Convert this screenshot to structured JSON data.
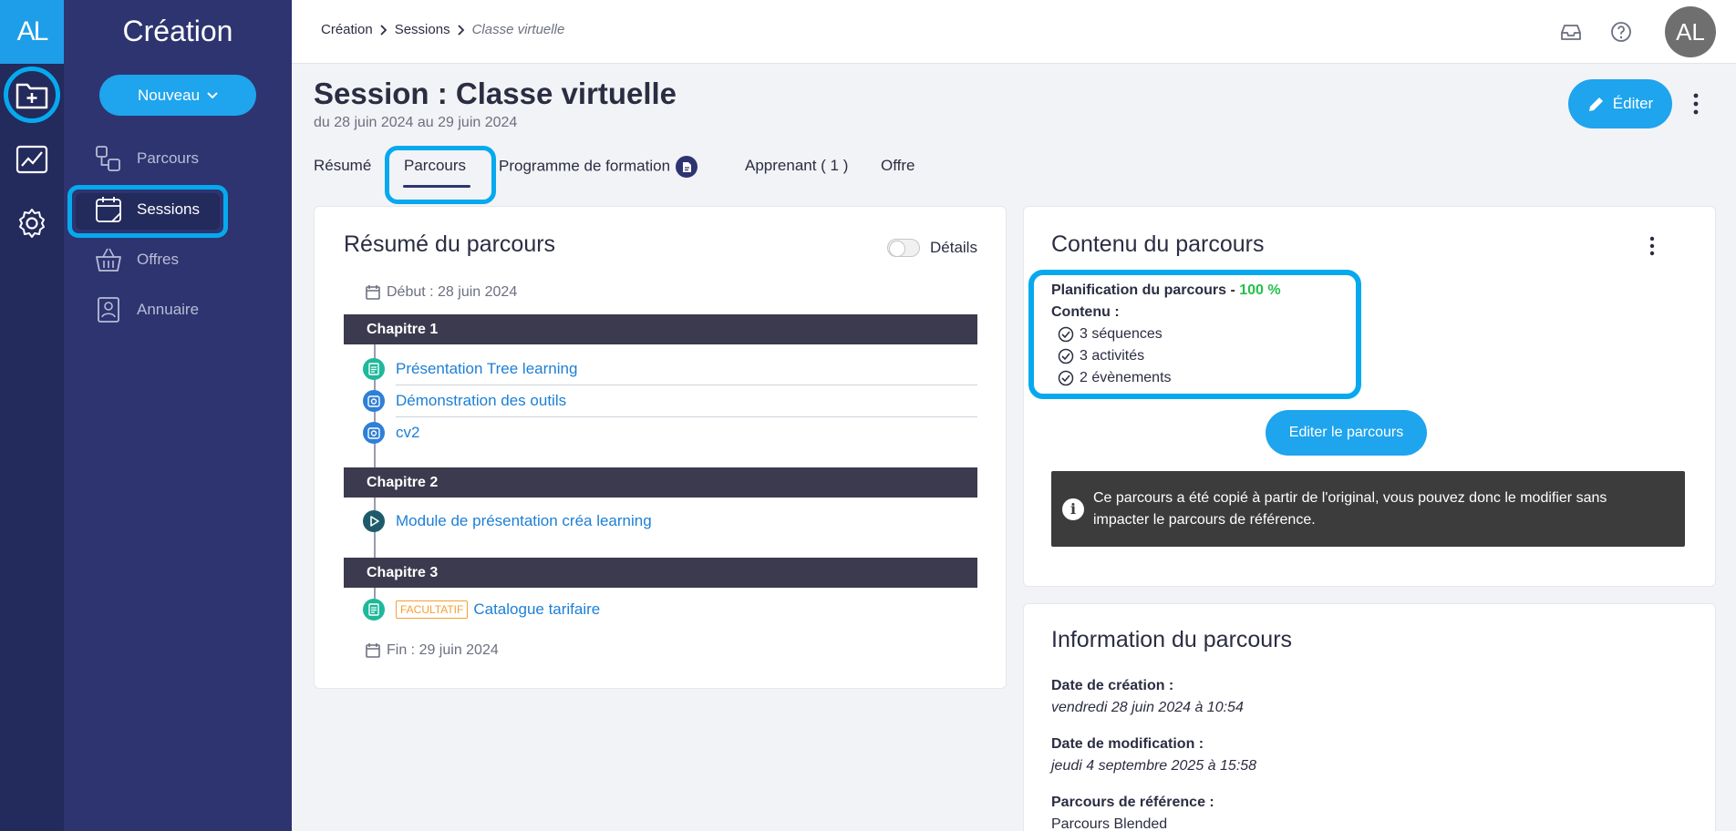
{
  "app": {
    "logo": "AL",
    "module_title": "Création"
  },
  "rail": {
    "icons": [
      "folder-plus-icon",
      "chart-icon",
      "gear-icon"
    ]
  },
  "sidebar": {
    "new_button": "Nouveau",
    "items": [
      {
        "label": "Parcours",
        "icon": "workflow-icon"
      },
      {
        "label": "Sessions",
        "icon": "calendar-icon"
      },
      {
        "label": "Offres",
        "icon": "basket-icon"
      },
      {
        "label": "Annuaire",
        "icon": "contact-book-icon"
      }
    ]
  },
  "breadcrumb": {
    "items": [
      "Création",
      "Sessions"
    ],
    "current": "Classe virtuelle"
  },
  "user": {
    "initials": "AL"
  },
  "page": {
    "title": "Session : Classe virtuelle",
    "dates": "du 28 juin 2024 au 29 juin 2024",
    "edit_label": "Éditer"
  },
  "tabs": [
    {
      "label": "Résumé"
    },
    {
      "label": "Parcours"
    },
    {
      "label": "Programme de formation"
    },
    {
      "label": "Apprenant ( 1 )"
    },
    {
      "label": "Offre"
    }
  ],
  "summary": {
    "title": "Résumé du parcours",
    "details_label": "Détails",
    "start": "Début : 28 juin 2024",
    "end": "Fin : 29 juin 2024",
    "chapters": [
      {
        "title": "Chapitre 1",
        "items": [
          "Présentation Tree learning",
          "Démonstration des outils",
          "cv2"
        ]
      },
      {
        "title": "Chapitre 2",
        "items": [
          "Module de présentation créa learning"
        ]
      },
      {
        "title": "Chapitre 3",
        "items": [
          "Catalogue tarifaire"
        ],
        "badge": "FACULTATIF"
      }
    ]
  },
  "content": {
    "title": "Contenu du parcours",
    "planning_label": "Planification du parcours - ",
    "planning_value": "100 %",
    "content_label": "Contenu :",
    "counts": [
      "3 séquences",
      "3 activités",
      "2 évènements"
    ],
    "edit_button": "Editer le parcours",
    "alert": "Ce parcours a été copié à partir de l'original, vous pouvez donc le modifier sans impacter le parcours de référence."
  },
  "information": {
    "title": "Information du parcours",
    "created_label": "Date de création :",
    "created_value": "vendredi 28 juin 2024 à 10:54",
    "modified_label": "Date de modification :",
    "modified_value": "jeudi 4 septembre 2025 à 15:58",
    "reference_label": "Parcours de référence :",
    "reference_value": "Parcours Blended"
  },
  "colors": {
    "accent": "#1fa4ee",
    "sidebar": "#2d3470",
    "rail": "#232a5c",
    "highlight": "#06a9ee",
    "success": "#22c04d"
  }
}
